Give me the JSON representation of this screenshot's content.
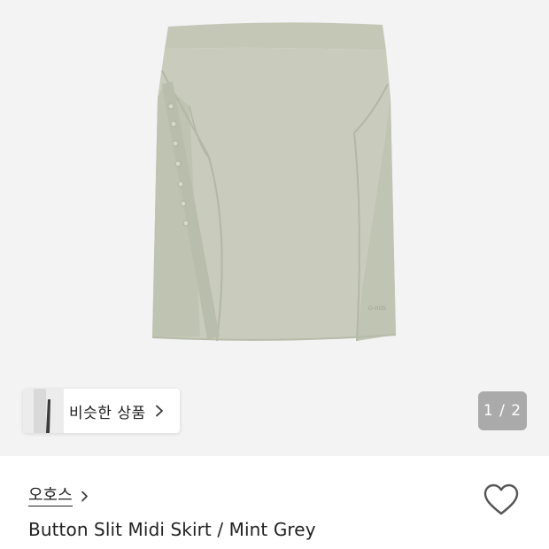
{
  "gallery": {
    "image_alt": "Button Slit Midi Skirt / Mint Grey product photo",
    "logo_text": "O-HOS",
    "similar_products_label": "비슷한 상품",
    "page_indicator": "1 / 2"
  },
  "product": {
    "brand": "오호스",
    "title": "Button Slit Midi Skirt / Mint Grey"
  },
  "colors": {
    "gallery_bg": "#f3f3f3",
    "skirt_main": "#c9ccbc",
    "skirt_shadow": "#b7bba9",
    "indicator_bg": "rgba(110,110,110,0.55)",
    "text": "#222222"
  },
  "icons": {
    "similar_chevron": "chevron-right-icon",
    "brand_chevron": "chevron-right-icon",
    "like": "heart-outline-icon"
  }
}
